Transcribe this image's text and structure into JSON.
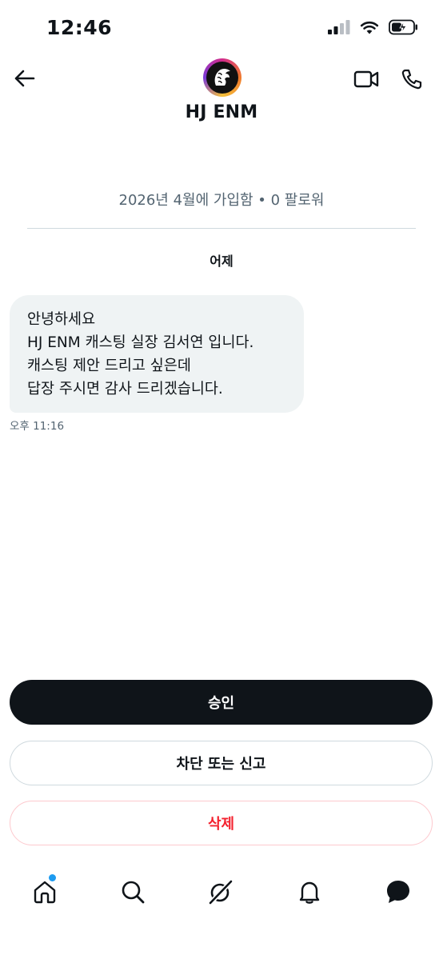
{
  "status_bar": {
    "time": "12:46"
  },
  "header": {
    "profile_name": "HJ ENM",
    "icons": [
      "back-arrow-icon",
      "video-call-icon",
      "phone-icon"
    ]
  },
  "profile_info": {
    "join_text": "2026년 4월에 가입함 • 0 팔로워"
  },
  "conversation": {
    "day_label": "어제",
    "messages": [
      {
        "lines": [
          "안녕하세요",
          "HJ ENM 캐스팅 실장 김서연 입니다.",
          "캐스팅 제안 드리고 싶은데",
          "답장 주시면 감사 드리겠습니다."
        ],
        "time": "오후 11:16"
      }
    ]
  },
  "actions": {
    "accept_label": "승인",
    "block_label": "차단 또는 신고",
    "delete_label": "삭제"
  },
  "colors": {
    "accept_bg": "#0f1419",
    "delete_text": "#f4212e",
    "bubble_bg": "#eff3f4",
    "notification_dot": "#1d9bf0"
  },
  "bottom_nav": {
    "items": [
      "home-icon",
      "search-icon",
      "grok-icon",
      "notifications-icon",
      "messages-icon"
    ]
  }
}
